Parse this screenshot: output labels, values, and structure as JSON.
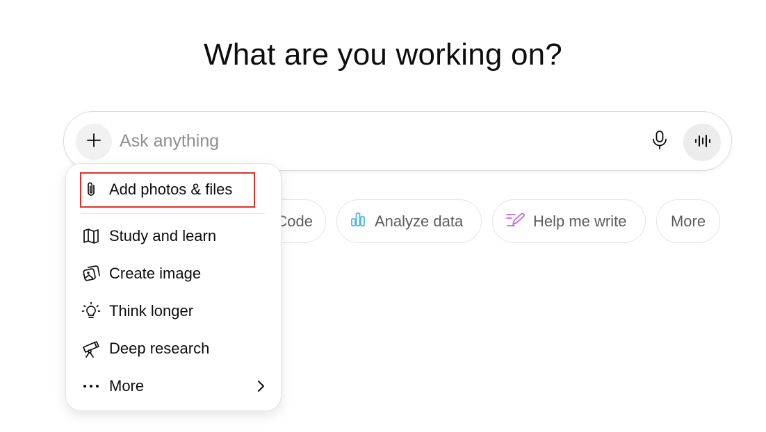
{
  "heading": "What are you working on?",
  "composer": {
    "placeholder": "Ask anything",
    "plus_icon": "plus-icon",
    "mic_icon": "microphone-icon",
    "voice_icon": "voice-waveform-icon"
  },
  "chips": [
    {
      "label": "Code",
      "icon": ""
    },
    {
      "label": "Analyze data",
      "icon": "bar-chart-icon",
      "color": "#4fb5de"
    },
    {
      "label": "Help me write",
      "icon": "pen-icon",
      "color": "#c46ad0"
    },
    {
      "label": "More",
      "icon": ""
    }
  ],
  "menu": {
    "items": [
      {
        "label": "Add photos & files",
        "icon": "paperclip-icon"
      },
      {
        "label": "Study and learn",
        "icon": "book-icon"
      },
      {
        "label": "Create image",
        "icon": "image-icon"
      },
      {
        "label": "Think longer",
        "icon": "lightbulb-icon"
      },
      {
        "label": "Deep research",
        "icon": "telescope-icon"
      },
      {
        "label": "More",
        "icon": "ellipsis-icon",
        "chevron": "chevron-right-icon"
      }
    ],
    "highlight_color": "#d9312b"
  }
}
